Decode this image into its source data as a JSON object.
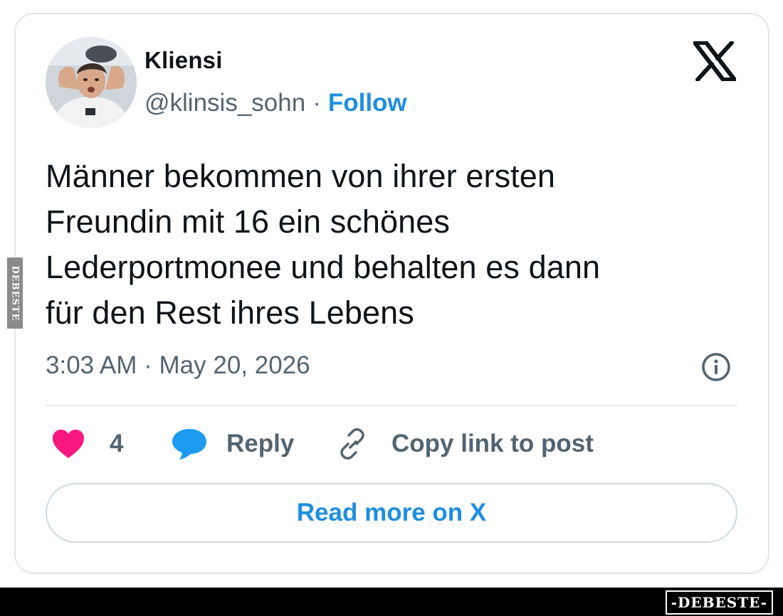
{
  "post": {
    "author": {
      "display_name": "Kliensi",
      "handle": "@klinsis_sohn",
      "separator": "·",
      "follow_label": "Follow",
      "avatar_icon": "profile-photo"
    },
    "platform_icon": "x-logo-icon",
    "text_lines": [
      "Männer bekommen von ihrer ersten",
      "Freundin mit 16 ein schönes",
      "Lederportmonee und behalten es dann",
      "für den Rest ihres Lebens"
    ],
    "timestamp": "3:03 AM · May 20, 2026",
    "info_icon": "info-icon",
    "actions": {
      "like_count": "4",
      "reply_label": "Reply",
      "copy_link_label": "Copy link to post"
    },
    "read_more_label": "Read more on X"
  },
  "watermark": {
    "side_text": "DEBESTE",
    "logo_text": "-DEBESTE-"
  },
  "colors": {
    "text": "#0f1419",
    "secondary": "#536471",
    "link": "#1d8fe0",
    "heart": "#f91880",
    "reply": "#1d9bf0",
    "border": "#e3e6e8"
  }
}
